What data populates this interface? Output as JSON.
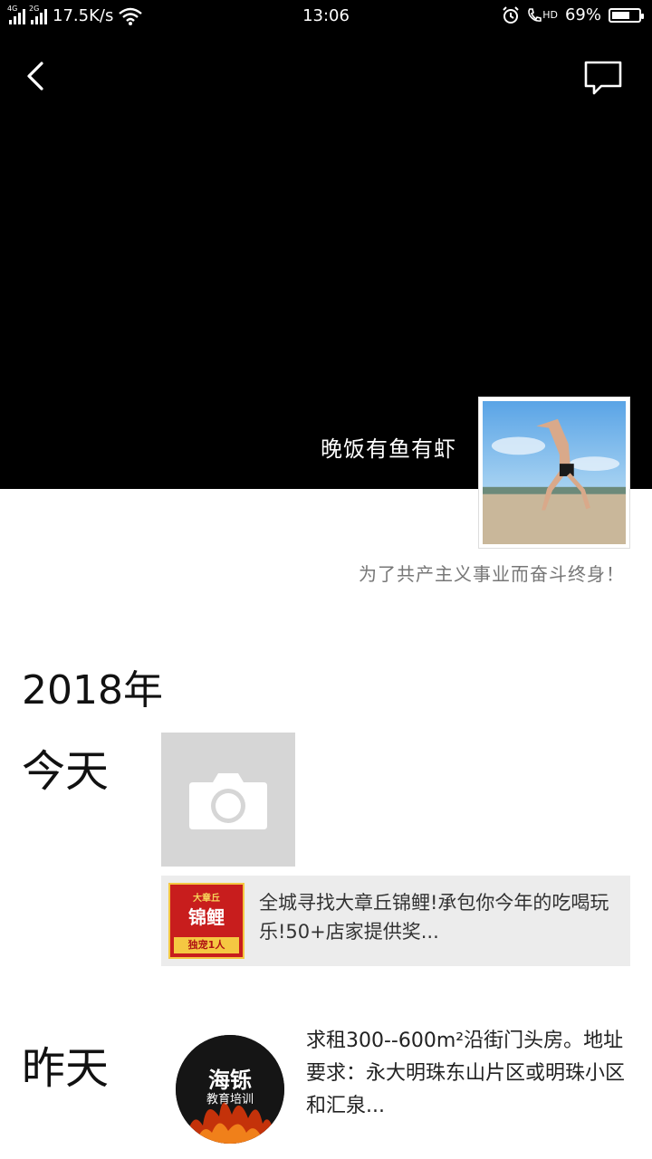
{
  "status_bar": {
    "net1": "4G",
    "net2": "2G",
    "speed": "17.5K/s",
    "time": "13:06",
    "hd": "HD",
    "battery_text": "69%",
    "battery_level": 0.69
  },
  "profile": {
    "nickname": "晚饭有鱼有虾",
    "signature": "为了共产主义事业而奋斗终身！"
  },
  "timeline": {
    "year": "2018年",
    "today_label": "今天",
    "yesterday_label": "昨天",
    "today_share": {
      "thumb_top": "大章丘",
      "thumb_main": "锦鲤",
      "thumb_bottom": "独宠1人",
      "text": "全城寻找大章丘锦鲤!承包你今年的吃喝玩乐!50+店家提供奖..."
    },
    "yesterday_post": {
      "avatar_title": "海铄",
      "avatar_subtitle": "教育培训",
      "text": "求租300--600m²沿街门头房。地址要求：永大明珠东山片区或明珠小区和汇泉..."
    }
  }
}
